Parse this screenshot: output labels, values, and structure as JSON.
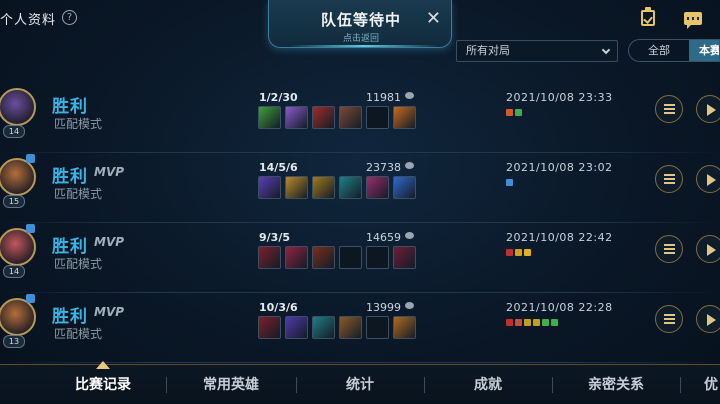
{
  "header": {
    "profile_title": "个人资料",
    "help_label": "?",
    "queue_title": "队伍等待中",
    "queue_subtitle": "点击返回",
    "close_label": "✕"
  },
  "filters": {
    "match_filter_value": "所有对局",
    "toggle_all": "全部",
    "toggle_season": "本赛"
  },
  "matches": [
    {
      "result": "胜利",
      "mvp": "",
      "mode": "匹配模式",
      "level": "14",
      "kda": "1/2/30",
      "gold": "11981",
      "datetime": "2021/10/08 23:33",
      "items": [
        "#3f9d3a",
        "#8a5acb",
        "#a02c2c",
        "#7b4a36",
        "",
        "#c76a1d"
      ],
      "tags": [
        "#d45a2a",
        "#3cb04a"
      ],
      "avatar_color": "#6a4fa0",
      "team_badge": false
    },
    {
      "result": "胜利",
      "mvp": "MVP",
      "mode": "匹配模式",
      "level": "15",
      "kda": "14/5/6",
      "gold": "23738",
      "datetime": "2021/10/08 23:02",
      "items": [
        "#5b3fb8",
        "#b88c2a",
        "#a07a1c",
        "#1f7f86",
        "#9a2d6b",
        "#2f6ad0"
      ],
      "tags": [
        "#3e8fd8"
      ],
      "avatar_color": "#b46e3a",
      "team_badge": true
    },
    {
      "result": "胜利",
      "mvp": "MVP",
      "mode": "匹配模式",
      "level": "14",
      "kda": "9/3/5",
      "gold": "14659",
      "datetime": "2021/10/08 22:42",
      "items": [
        "#7d1f2a",
        "#8f2440",
        "#7a2e1c",
        "",
        "",
        "#6b1e38"
      ],
      "tags": [
        "#c03030",
        "#d0a020",
        "#e0b020"
      ],
      "avatar_color": "#c0585a",
      "team_badge": true
    },
    {
      "result": "胜利",
      "mvp": "MVP",
      "mode": "匹配模式",
      "level": "13",
      "kda": "10/3/6",
      "gold": "13999",
      "datetime": "2021/10/08 22:28",
      "items": [
        "#7d1f2a",
        "#4f3aa8",
        "#1f7f86",
        "#8a5a2a",
        "",
        "#b06a20"
      ],
      "tags": [
        "#c03030",
        "#c05040",
        "#c0a020",
        "#c0a020",
        "#3cb04a",
        "#3cb04a"
      ],
      "avatar_color": "#b46e3a",
      "team_badge": true
    }
  ],
  "bottom_nav": {
    "items": [
      "比赛记录",
      "常用英雄",
      "统计",
      "成就",
      "亲密关系",
      "优"
    ]
  }
}
